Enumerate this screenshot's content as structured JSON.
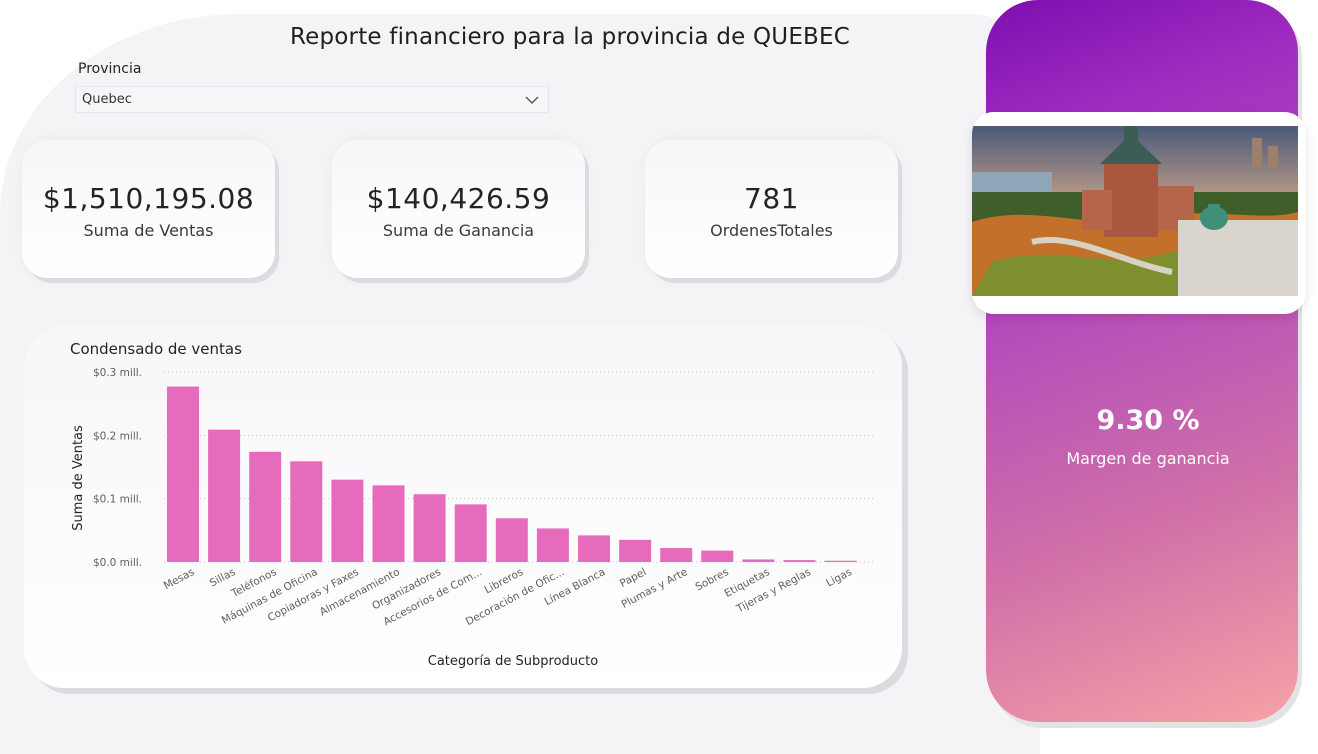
{
  "report": {
    "title": "Reporte financiero para la provincia de QUEBEC"
  },
  "slicer": {
    "label": "Provincia",
    "selected": "Quebec"
  },
  "cards": [
    {
      "value": "$1,510,195.08",
      "label": "Suma de Ventas"
    },
    {
      "value": "$140,426.59",
      "label": "Suma de Ganancia"
    },
    {
      "value": "781",
      "label": "OrdenesTotales"
    }
  ],
  "margin_kpi": {
    "value": "9.30 %",
    "label": "Margen de ganancia"
  },
  "colors": {
    "bar": "#e66bbd",
    "panel_top": "#7b0fb0",
    "panel_bottom": "#f7a2a6"
  },
  "chart_data": {
    "type": "bar",
    "title": "Condensado de ventas",
    "xlabel": "Categoría de Subproducto",
    "ylabel": "Suma de Ventas",
    "yticks": [
      "$0.0 mill.",
      "$0.1 mill.",
      "$0.2 mill.",
      "$0.3 mill."
    ],
    "ylim": [
      0,
      0.3
    ],
    "categories": [
      "Mesas",
      "Sillas",
      "Teléfonos",
      "Máquinas de Oficina",
      "Copiadoras y Faxes",
      "Almacenamiento",
      "Organizadores",
      "Accesorios de Com...",
      "Libreros",
      "Decoración de Ofic...",
      "Línea Blanca",
      "Papel",
      "Plumas y Arte",
      "Sobres",
      "Etiquetas",
      "Tijeras y Reglas",
      "Ligas"
    ],
    "values": [
      0.277,
      0.209,
      0.174,
      0.159,
      0.13,
      0.121,
      0.107,
      0.091,
      0.069,
      0.053,
      0.042,
      0.035,
      0.022,
      0.018,
      0.004,
      0.003,
      0.002
    ],
    "grid": true
  }
}
